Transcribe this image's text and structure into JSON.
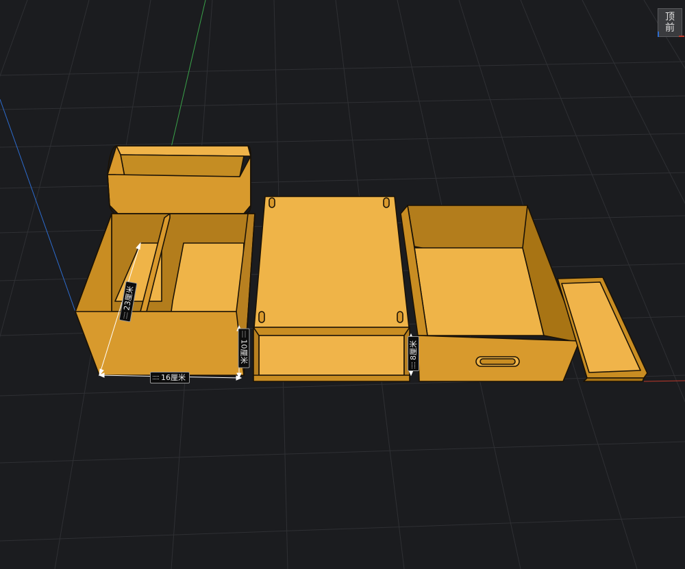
{
  "view_cube": {
    "top_label": "顶",
    "front_label": "前"
  },
  "dimensions": {
    "width": "16厘米",
    "depth": "23厘米",
    "height_left": "10厘米",
    "height_middle": "8厘米"
  },
  "colors": {
    "background": "#1b1c1f",
    "grid": "#2f3034",
    "part_light": "#f0b44a",
    "part_mid": "#d79a2b",
    "part_dark": "#a87414",
    "outline": "#1a1206",
    "axis_red": "#c0392b",
    "axis_green": "#3aa34a",
    "axis_blue": "#2d6ccf"
  }
}
